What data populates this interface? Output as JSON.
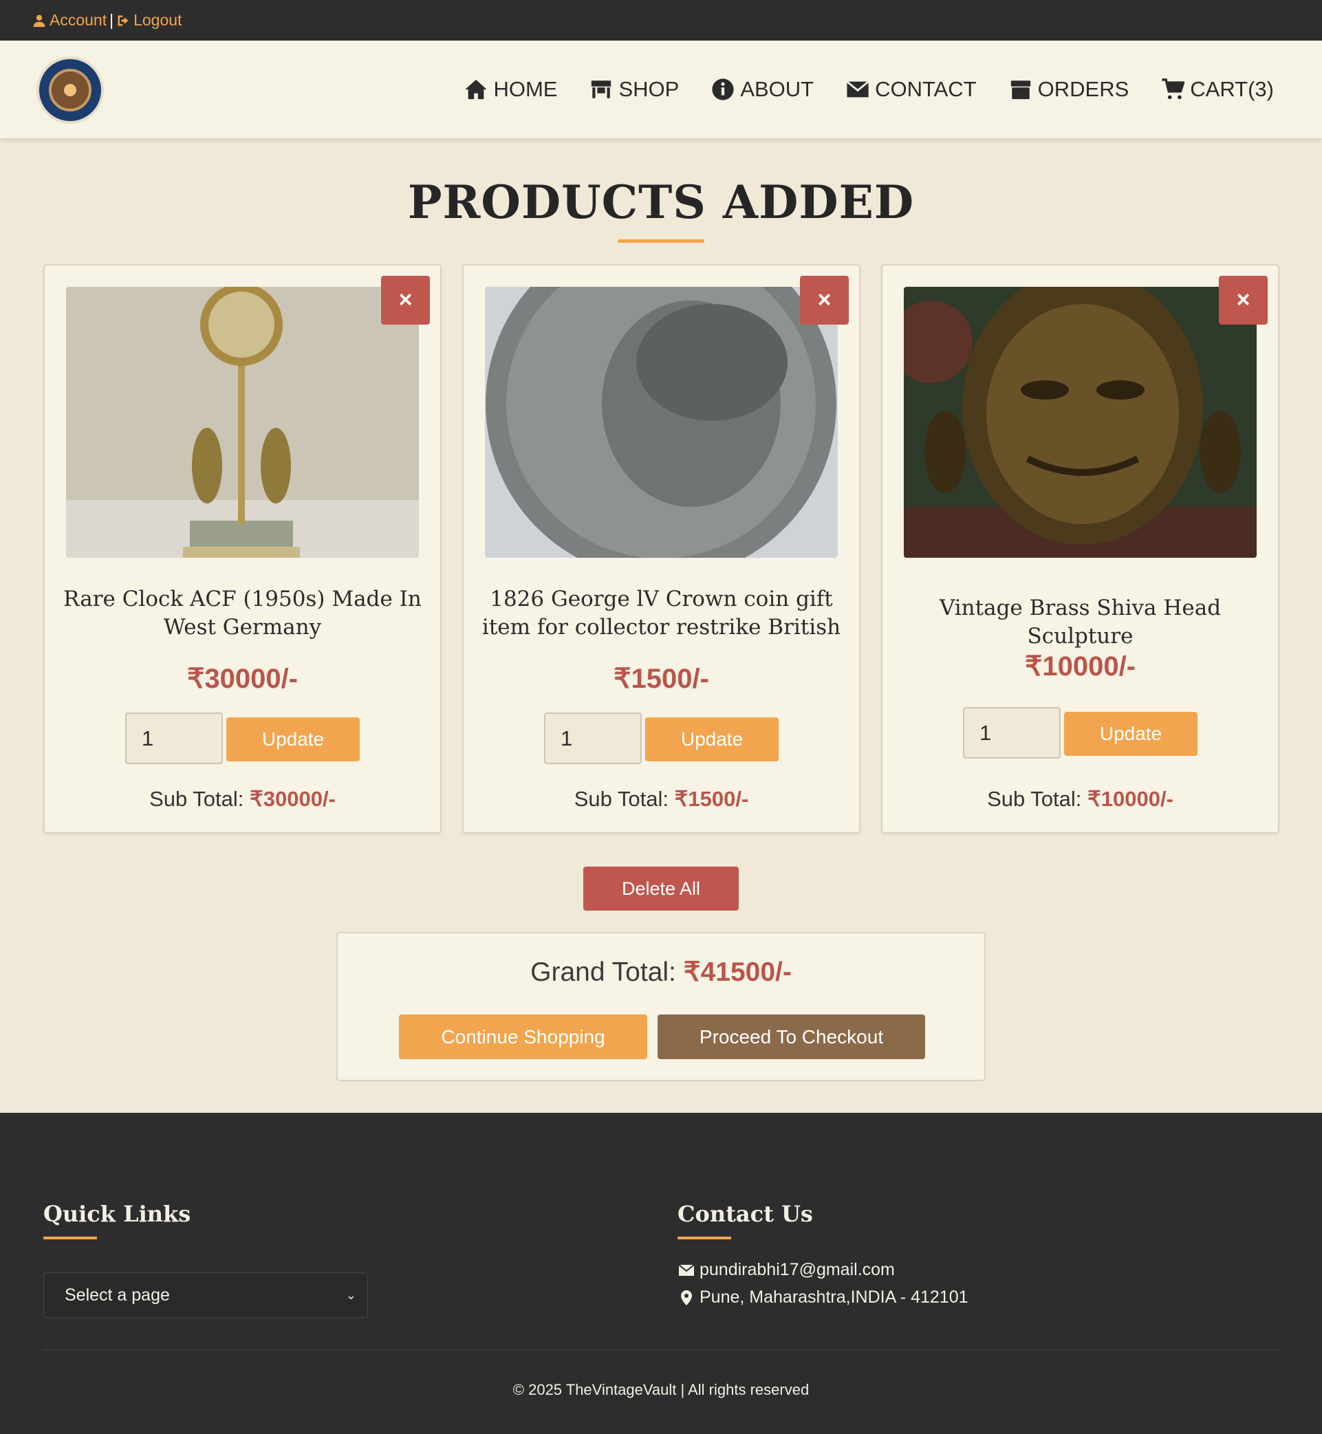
{
  "topbar": {
    "account": "Account",
    "separator": "|",
    "logout": "Logout"
  },
  "brand": {
    "logo_alt": "The Vintage Vault 2024 logo"
  },
  "nav": [
    {
      "label": "HOME",
      "icon": "home-icon"
    },
    {
      "label": "SHOP",
      "icon": "store-icon"
    },
    {
      "label": "ABOUT",
      "icon": "info-icon"
    },
    {
      "label": "CONTACT",
      "icon": "envelope-icon"
    },
    {
      "label": "ORDERS",
      "icon": "box-icon"
    },
    {
      "label": "CART(3)",
      "icon": "cart-icon"
    }
  ],
  "page": {
    "title": "PRODUCTS ADDED"
  },
  "cart": {
    "items": [
      {
        "name": "Rare Clock ACF (1950s) Made In West Germany",
        "price": "₹30000/-",
        "qty": "1",
        "update_label": "Update",
        "subtotal_label": "Sub Total:",
        "subtotal": "₹30000/-",
        "remove": "×"
      },
      {
        "name": "1826 George lV Crown coin gift item for collector restrike British",
        "price": "₹1500/-",
        "qty": "1",
        "update_label": "Update",
        "subtotal_label": "Sub Total:",
        "subtotal": "₹1500/-",
        "remove": "×"
      },
      {
        "name": "Vintage Brass Shiva Head Sculpture",
        "price": "₹10000/-",
        "qty": "1",
        "update_label": "Update",
        "subtotal_label": "Sub Total:",
        "subtotal": "₹10000/-",
        "remove": "×"
      }
    ],
    "delete_all": "Delete All",
    "grand_total_label": "Grand Total:",
    "grand_total": "₹41500/-",
    "continue_label": "Continue Shopping",
    "checkout_label": "Proceed To Checkout"
  },
  "footer": {
    "quick_links_title": "Quick Links",
    "select_placeholder": "Select a page",
    "contact_title": "Contact Us",
    "email": "pundirabhi17@gmail.com",
    "address": "Pune, Maharashtra,INDIA - 412101",
    "copyright": "© 2025 TheVintageVault | All rights reserved"
  },
  "colors": {
    "accent": "#f2a54e",
    "danger": "#bf574e",
    "price": "#b9554a",
    "dark": "#2d2d2d",
    "brown": "#8b6a4a"
  }
}
